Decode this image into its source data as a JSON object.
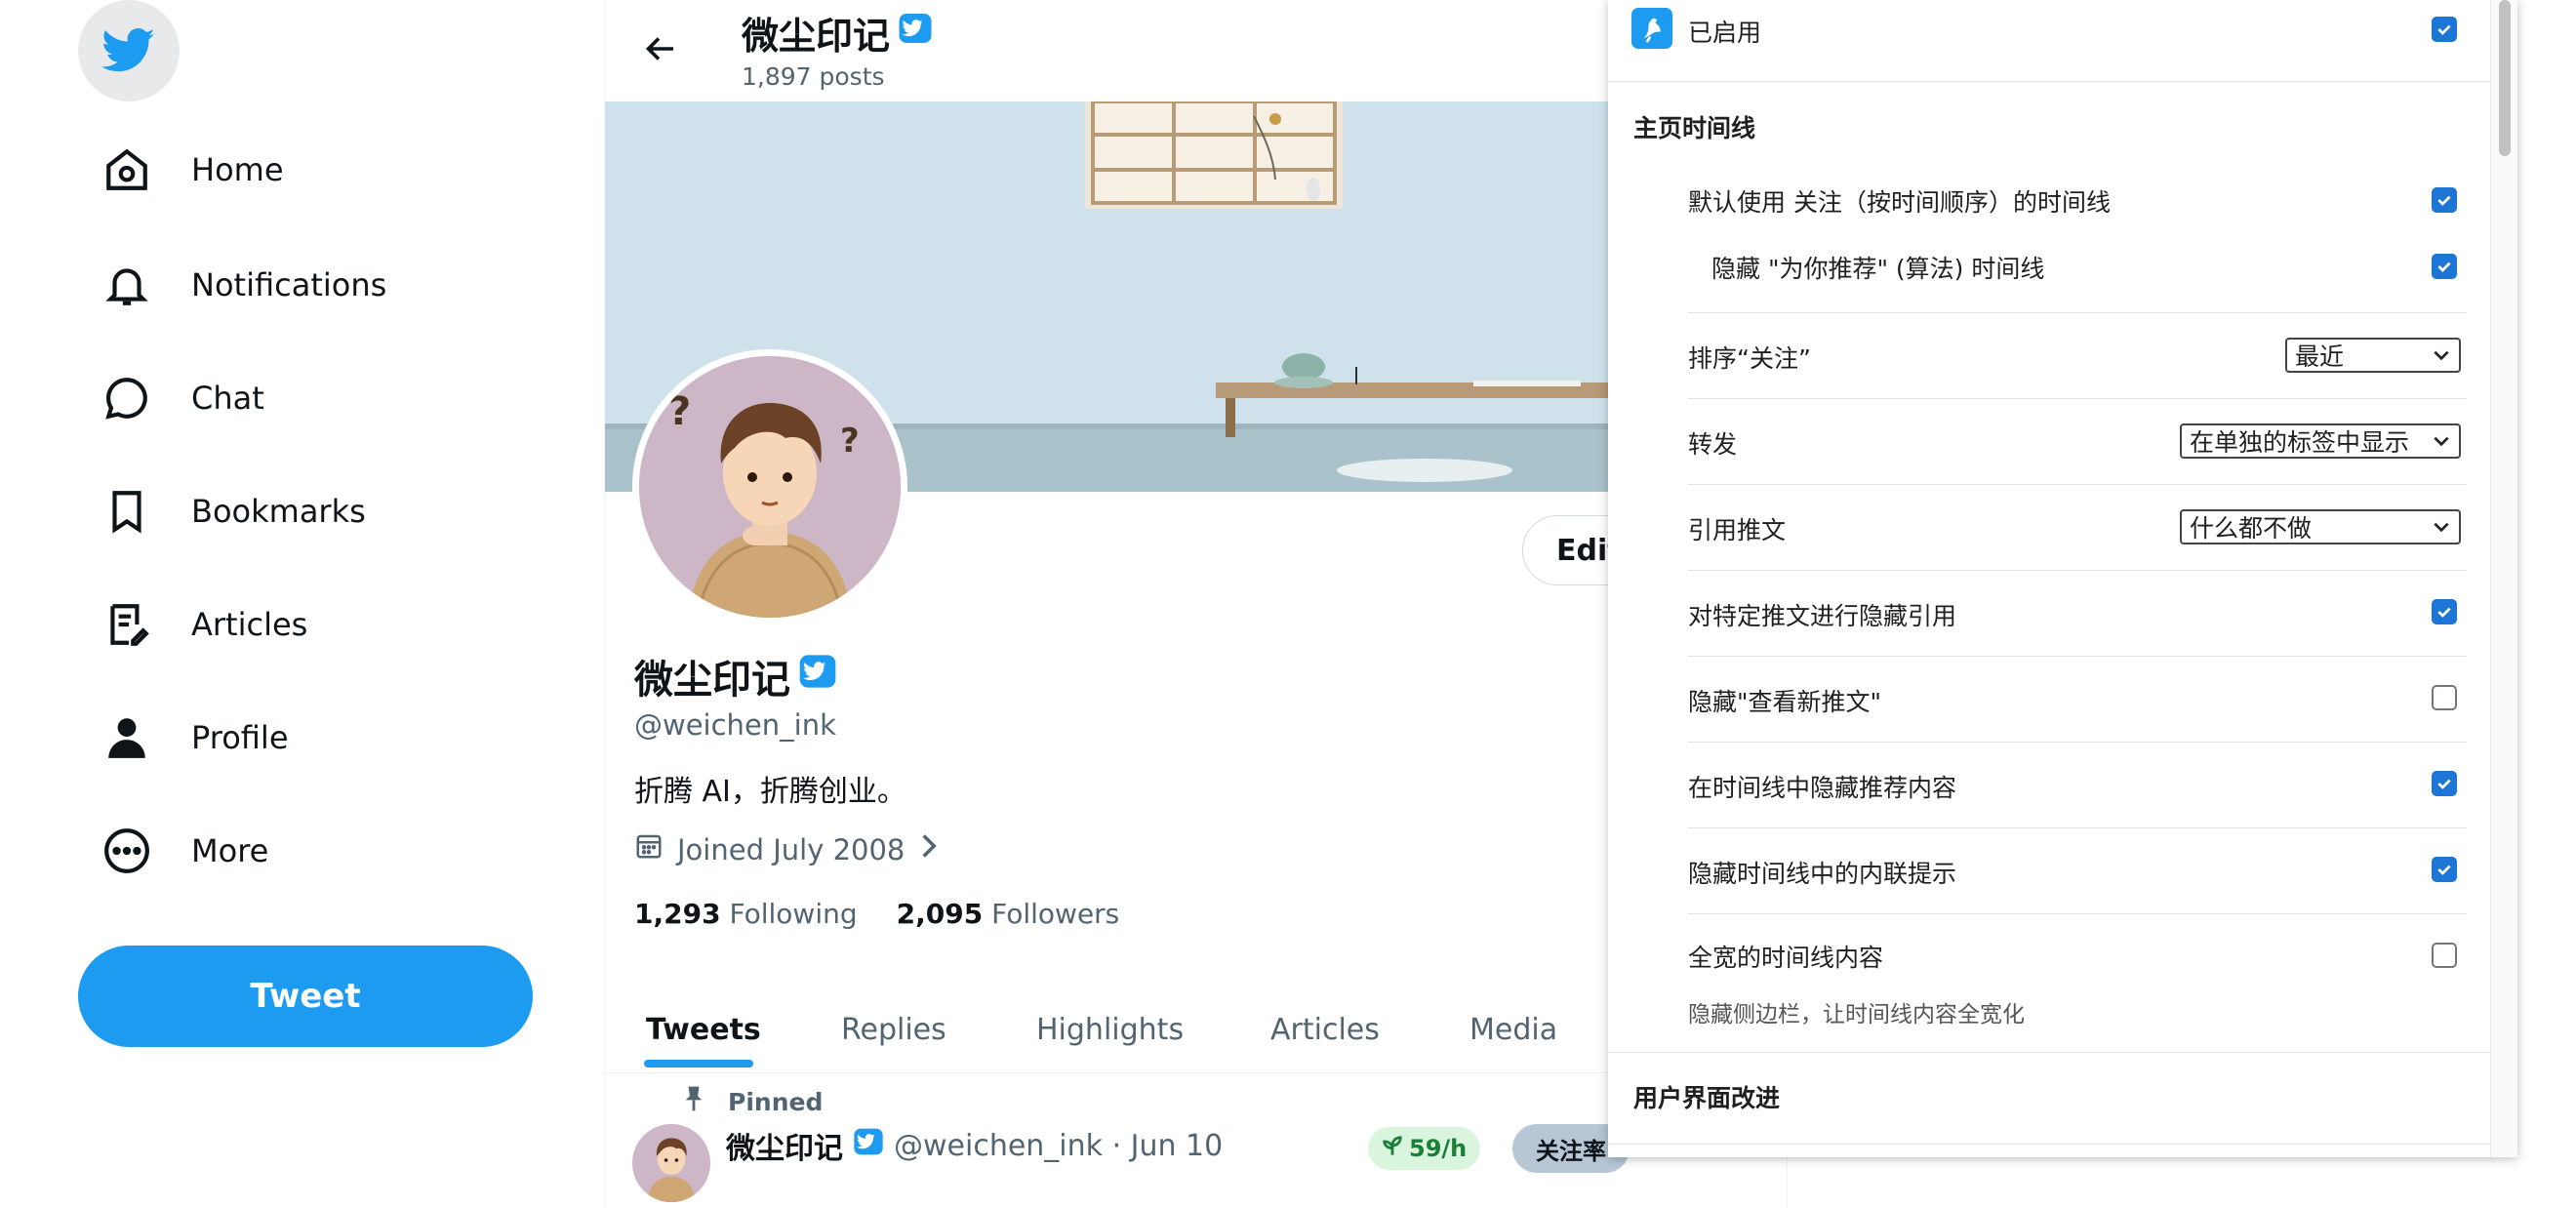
{
  "nav": {
    "items": [
      {
        "label": "Home",
        "icon": "home-icon"
      },
      {
        "label": "Notifications",
        "icon": "bell-icon"
      },
      {
        "label": "Chat",
        "icon": "chat-icon"
      },
      {
        "label": "Bookmarks",
        "icon": "bookmark-icon"
      },
      {
        "label": "Articles",
        "icon": "articles-icon"
      },
      {
        "label": "Profile",
        "icon": "profile-icon"
      },
      {
        "label": "More",
        "icon": "more-icon"
      }
    ],
    "tweet_label": "Tweet"
  },
  "header": {
    "name": "微尘印记",
    "posts": "1,897 posts"
  },
  "profile": {
    "name": "微尘印记",
    "handle": "@weichen_ink",
    "bio": "折腾 AI，折腾创业。",
    "joined": "Joined July 2008",
    "following_count": "1,293",
    "following_label": "Following",
    "followers_count": "2,095",
    "followers_label": "Followers",
    "edit_label": "Edit"
  },
  "tabs": [
    {
      "label": "Tweets",
      "active": true
    },
    {
      "label": "Replies"
    },
    {
      "label": "Highlights"
    },
    {
      "label": "Articles"
    },
    {
      "label": "Media"
    }
  ],
  "tweet": {
    "pinned_label": "Pinned",
    "name": "微尘印记",
    "handle_time": "@weichen_ink · Jun 10",
    "rate": "59/h",
    "follow_rate": "关注率"
  },
  "panel": {
    "enabled_label": "已启用",
    "section_home": "主页时间线",
    "default_following": "默认使用 关注（按时间顺序）的时间线",
    "hide_for_you": "隐藏 \"为你推荐\" (算法) 时间线",
    "sort_label": "排序“关注”",
    "sort_value": "最近",
    "retweet_label": "转发",
    "retweet_value": "在单独的标签中显示",
    "quote_label": "引用推文",
    "quote_value": "什么都不做",
    "hide_quote_specific": "对特定推文进行隐藏引用",
    "hide_new_tweets": "隐藏\"查看新推文\"",
    "hide_recommended": "在时间线中隐藏推荐内容",
    "hide_inline_prompts": "隐藏时间线中的内联提示",
    "full_width": "全宽的时间线内容",
    "full_width_desc": "隐藏侧边栏，让时间线内容全宽化",
    "section_ui": "用户界面改进"
  },
  "colors": {
    "accent": "#1d9bf0",
    "checkbox": "#1d75d6"
  }
}
